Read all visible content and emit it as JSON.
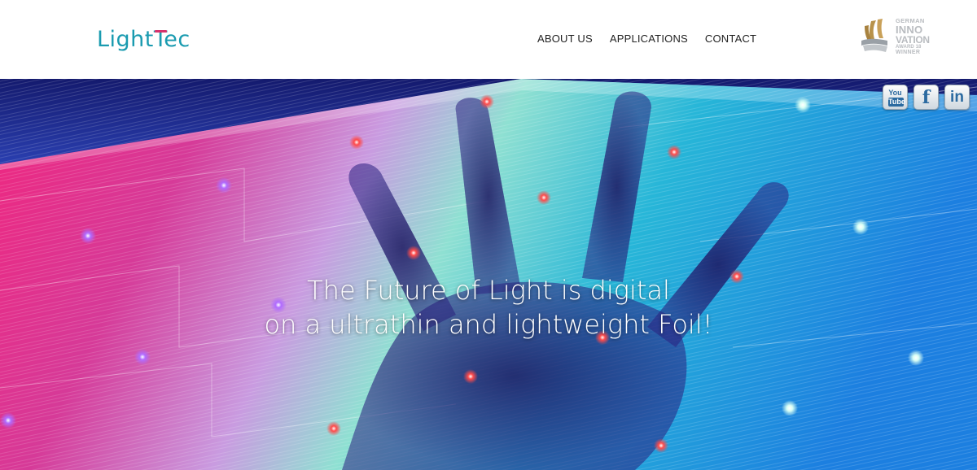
{
  "header": {
    "logo": {
      "part1": "Light",
      "part2": "Tec"
    },
    "nav": [
      "ABOUT US",
      "APPLICATIONS",
      "CONTACT"
    ],
    "award": {
      "lines": [
        "GERMAN",
        "INNO",
        "VATION",
        "AWARD 18",
        "WINNER"
      ]
    }
  },
  "hero": {
    "headline_line1": "The Future of Light is digital",
    "headline_line2": "on a ultrathin and lightweight Foil!"
  },
  "social": {
    "youtube": {
      "top": "You",
      "bottom": "Tube",
      "icon": "youtube-icon"
    },
    "facebook": {
      "glyph": "f",
      "icon": "facebook-icon"
    },
    "linkedin": {
      "glyph": "in",
      "icon": "linkedin-icon"
    }
  },
  "colors": {
    "brand": "#1a9bb0",
    "brand_accent": "#d6336c",
    "nav_text": "#222222",
    "award_gold": "#b8924a",
    "award_grey": "#b9bcc0"
  }
}
